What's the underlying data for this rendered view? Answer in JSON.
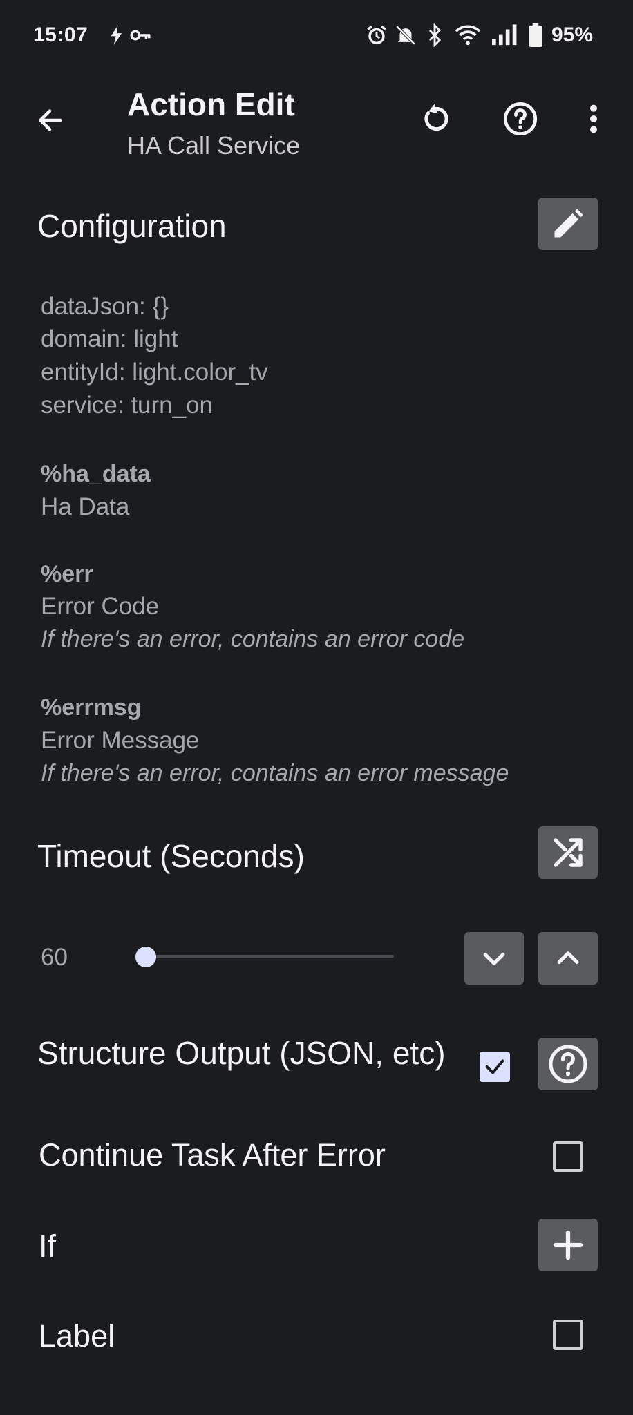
{
  "status_bar": {
    "time": "15:07",
    "battery": "95%",
    "icons": [
      "flash-icon",
      "key-icon",
      "alarm-icon",
      "mute-icon",
      "bluetooth-icon",
      "wifi-icon",
      "signal-icon",
      "battery-icon"
    ]
  },
  "app_bar": {
    "title": "Action Edit",
    "subtitle": "HA Call Service"
  },
  "configuration": {
    "title": "Configuration",
    "lines": [
      "dataJson: {}",
      "domain: light",
      "entityId: light.color_tv",
      "service: turn_on"
    ]
  },
  "variables": [
    {
      "name": "%ha_data",
      "label": "Ha Data",
      "desc": ""
    },
    {
      "name": "%err",
      "label": "Error Code",
      "desc": "If there's an error, contains an error code"
    },
    {
      "name": "%errmsg",
      "label": "Error Message",
      "desc": "If there's an error, contains an error message"
    }
  ],
  "timeout": {
    "title": "Timeout (Seconds)",
    "value": "60"
  },
  "structure_output": {
    "label": "Structure Output (JSON, etc)",
    "checked": true
  },
  "continue_after_error": {
    "label": "Continue Task After Error",
    "checked": false
  },
  "if_row": {
    "label": "If"
  },
  "label_row": {
    "label": "Label",
    "checked": false
  },
  "colors": {
    "background": "#1b1c20",
    "button_bg": "#5a5b5f",
    "accent": "#dbe1ff",
    "secondary_text": "#a7a8ad"
  }
}
